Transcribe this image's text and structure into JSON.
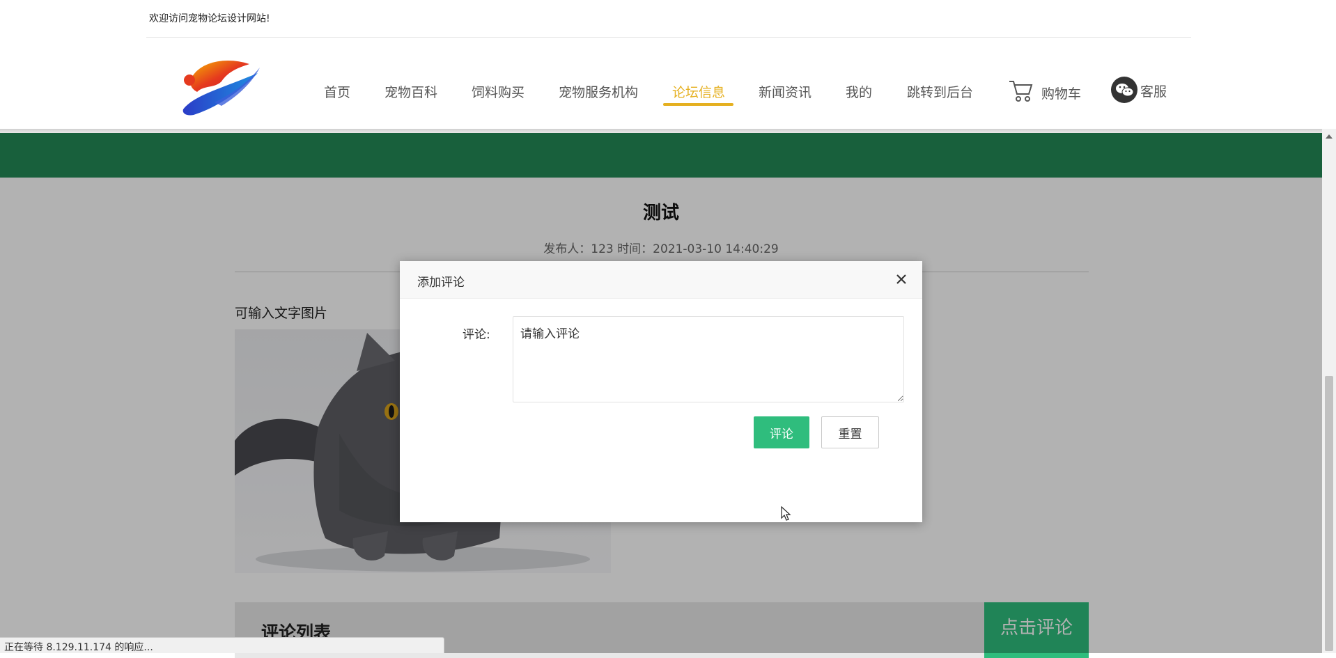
{
  "topbar": {
    "welcome": "欢迎访问宠物论坛设计网站!"
  },
  "logo": {
    "icon": "brand-logo-icon"
  },
  "nav": {
    "items": [
      {
        "label": "首页",
        "active": false
      },
      {
        "label": "宠物百科",
        "active": false
      },
      {
        "label": "饲料购买",
        "active": false
      },
      {
        "label": "宠物服务机构",
        "active": false
      },
      {
        "label": "论坛信息",
        "active": true
      },
      {
        "label": "新闻资讯",
        "active": false
      },
      {
        "label": "我的",
        "active": false
      },
      {
        "label": "跳转到后台",
        "active": false
      }
    ],
    "cart": "购物车",
    "service": "客服",
    "active_color": "#e5b020"
  },
  "article": {
    "title": "测试",
    "meta": "发布人：123 时间：2021-03-10 14:40:29",
    "content": "可输入文字图片"
  },
  "comments": {
    "title": "评论列表",
    "add_button": "点击评论"
  },
  "modal": {
    "title": "添加评论",
    "label": "评论:",
    "placeholder": "请输入评论",
    "submit": "评论",
    "reset": "重置"
  },
  "status": {
    "text": "正在等待 8.129.11.174 的响应..."
  },
  "colors": {
    "green_band": "#238a57",
    "button_green": "#2fbd7d",
    "accent": "#e5b020"
  }
}
